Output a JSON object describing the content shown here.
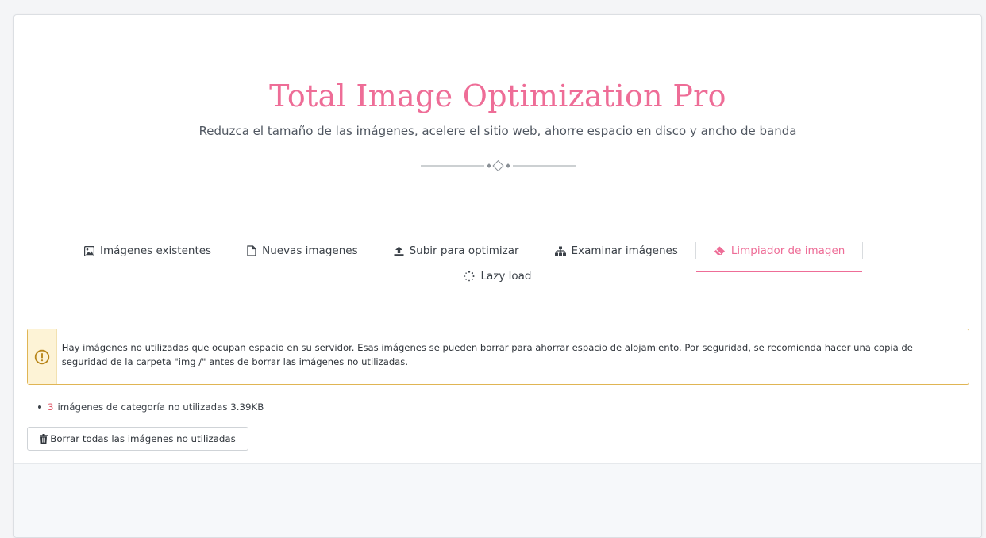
{
  "header": {
    "title": "Total Image Optimization Pro",
    "subtitle": "Reduzca el tamaño de las imágenes, acelere el sitio web, ahorre espacio en disco y ancho de banda"
  },
  "tabs": [
    {
      "label": "Imágenes existentes",
      "icon": "image-icon"
    },
    {
      "label": "Nuevas imagenes",
      "icon": "file-icon"
    },
    {
      "label": "Subir para optimizar",
      "icon": "upload-icon"
    },
    {
      "label": "Examinar imágenes",
      "icon": "sitemap-icon"
    },
    {
      "label": "Limpiador de imagen",
      "icon": "eraser-icon",
      "active": true
    },
    {
      "label": "Lazy load",
      "icon": "spinner-icon"
    }
  ],
  "alert": {
    "text": "Hay imágenes no utilizadas que ocupan espacio en su servidor. Esas imágenes se pueden borrar para ahorrar espacio de alojamiento. Por seguridad, se recomienda hacer una copia de seguridad de la carpeta \"img /\" antes de borrar las imágenes no utilizadas."
  },
  "unused": {
    "count": "3",
    "text": "imágenes de categoría no utilizadas 3.39KB"
  },
  "actions": {
    "delete_label": "Borrar todas las imágenes no utilizadas"
  },
  "colors": {
    "accent": "#ee6d97",
    "warning_border": "#e0b554",
    "warning_bg": "#fdf3d6"
  }
}
